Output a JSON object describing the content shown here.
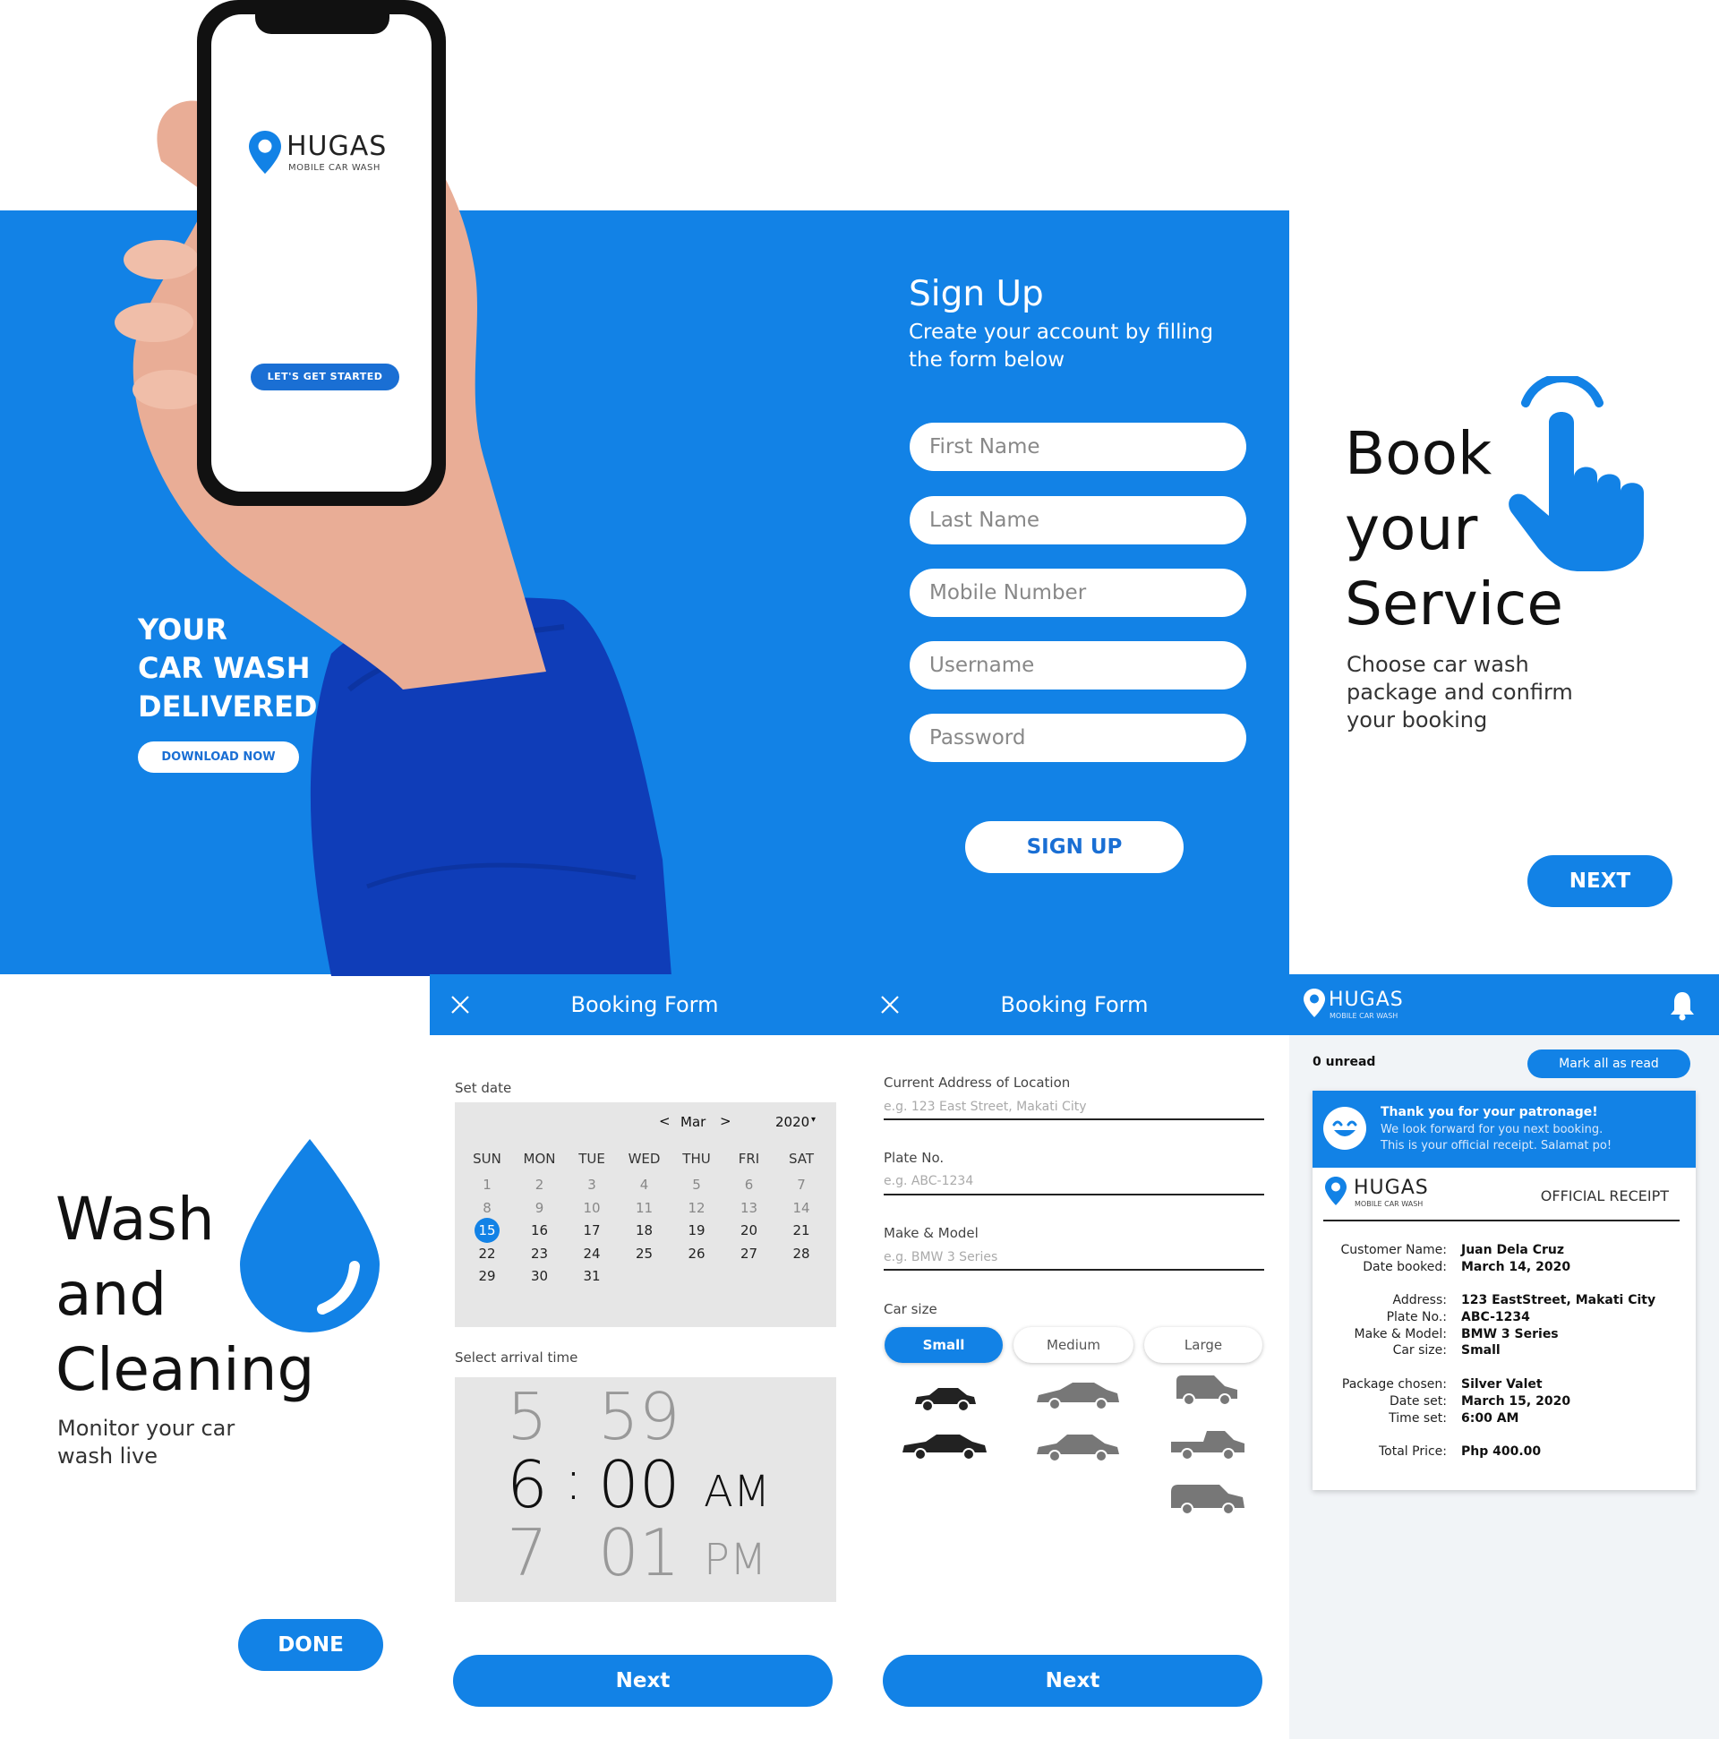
{
  "brand": {
    "name": "HUGAS",
    "tagline": "MOBILE CAR WASH",
    "accent": "#1282e6",
    "icon": "location-pin-icon"
  },
  "hero": {
    "phone_button": "LET'S GET STARTED",
    "tagline_lines": [
      "YOUR",
      "CAR WASH",
      "DELIVERED"
    ],
    "download_button": "DOWNLOAD NOW"
  },
  "signup": {
    "title": "Sign Up",
    "subtitle": "Create your account by filling the form below",
    "fields": {
      "first_name": "First Name",
      "last_name": "Last Name",
      "mobile": "Mobile Number",
      "username": "Username",
      "password": "Password"
    },
    "submit": "SIGN UP"
  },
  "book": {
    "title_lines": [
      "Book",
      "your",
      "Service"
    ],
    "subtitle": "Choose car wash package and confirm your booking",
    "icon": "pointing-hand-icon",
    "next": "NEXT"
  },
  "wash": {
    "title_lines": [
      "Wash",
      "and",
      "Cleaning"
    ],
    "subtitle": "Monitor your car wash live",
    "icon": "water-drop-icon",
    "done": "DONE"
  },
  "booking_date": {
    "title": "Booking Form",
    "set_date_label": "Set date",
    "month": "Mar",
    "year": "2020",
    "prev": "<",
    "next_arrow": ">",
    "year_caret": "▾",
    "weekdays": [
      "SUN",
      "MON",
      "TUE",
      "WED",
      "THU",
      "FRI",
      "SAT"
    ],
    "weeks": [
      [
        "1",
        "2",
        "3",
        "4",
        "5",
        "6",
        "7"
      ],
      [
        "8",
        "9",
        "10",
        "11",
        "12",
        "13",
        "14"
      ],
      [
        "15",
        "16",
        "17",
        "18",
        "19",
        "20",
        "21"
      ],
      [
        "22",
        "23",
        "24",
        "25",
        "26",
        "27",
        "28"
      ],
      [
        "29",
        "30",
        "31",
        "",
        "",
        "",
        ""
      ]
    ],
    "selected_day": "15",
    "time_label": "Select arrival time",
    "time": {
      "hour_prev": "5",
      "hour": "6",
      "hour_next": "7",
      "min_prev": "59",
      "min": "00",
      "min_next": "01",
      "separator": ":",
      "ampm": "AM",
      "ampm_next": "PM"
    },
    "next": "Next"
  },
  "booking_details": {
    "title": "Booking Form",
    "address_label": "Current Address of Location",
    "address_placeholder": "e.g. 123 East Street, Makati City",
    "plate_label": "Plate No.",
    "plate_placeholder": "e.g. ABC-1234",
    "make_label": "Make & Model",
    "make_placeholder": "e.g. BMW 3 Series",
    "car_size_label": "Car size",
    "sizes": [
      "Small",
      "Medium",
      "Large"
    ],
    "selected_size": "Small",
    "next": "Next"
  },
  "notifications": {
    "unread": "0 unread",
    "mark_all": "Mark all as read",
    "bell_icon": "bell-icon",
    "message_title": "Thank you for your patronage!",
    "message_line1": "We look forward for you next booking.",
    "message_line2": "This is your official receipt. Salamat po!",
    "receipt_title": "OFFICIAL RECEIPT",
    "rows": [
      {
        "k": "Customer Name:",
        "v": "Juan Dela Cruz"
      },
      {
        "k": "Date booked:",
        "v": "March 14, 2020"
      },
      {
        "k": "Address:",
        "v": "123 EastStreet, Makati City"
      },
      {
        "k": "Plate No.:",
        "v": "ABC-1234"
      },
      {
        "k": "Make & Model:",
        "v": "BMW 3 Series"
      },
      {
        "k": "Car size:",
        "v": "Small"
      },
      {
        "k": "Package chosen:",
        "v": "Silver Valet"
      },
      {
        "k": "Date set:",
        "v": "March 15, 2020"
      },
      {
        "k": "Time set:",
        "v": "6:00 AM"
      },
      {
        "k": "Total Price:",
        "v": "Php 400.00"
      }
    ]
  }
}
